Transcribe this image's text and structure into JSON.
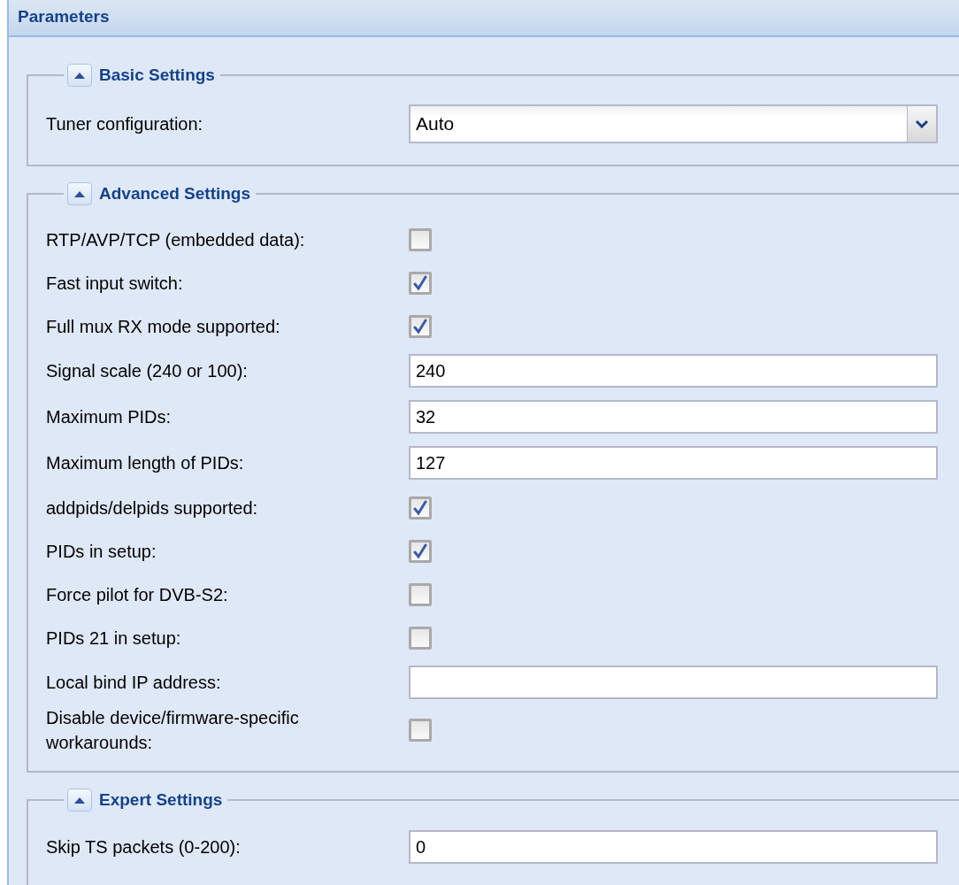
{
  "panel": {
    "title": "Parameters"
  },
  "sections": [
    {
      "title": "Basic Settings",
      "expanded": true,
      "rows": [
        {
          "kind": "select",
          "label": "Tuner configuration:",
          "value": "Auto"
        }
      ]
    },
    {
      "title": "Advanced Settings",
      "expanded": true,
      "rows": [
        {
          "kind": "checkbox",
          "label": "RTP/AVP/TCP (embedded data):",
          "checked": false
        },
        {
          "kind": "checkbox",
          "label": "Fast input switch:",
          "checked": true
        },
        {
          "kind": "checkbox",
          "label": "Full mux RX mode supported:",
          "checked": true
        },
        {
          "kind": "text",
          "label": "Signal scale (240 or 100):",
          "value": "240"
        },
        {
          "kind": "text",
          "label": "Maximum PIDs:",
          "value": "32"
        },
        {
          "kind": "text",
          "label": "Maximum length of PIDs:",
          "value": "127"
        },
        {
          "kind": "checkbox",
          "label": "addpids/delpids supported:",
          "checked": true
        },
        {
          "kind": "checkbox",
          "label": "PIDs in setup:",
          "checked": true
        },
        {
          "kind": "checkbox",
          "label": "Force pilot for DVB-S2:",
          "checked": false
        },
        {
          "kind": "checkbox",
          "label": "PIDs 21 in setup:",
          "checked": false
        },
        {
          "kind": "text",
          "label": "Local bind IP address:",
          "value": ""
        },
        {
          "kind": "checkbox",
          "label": "Disable device/firmware-specific workarounds:",
          "checked": false
        }
      ]
    },
    {
      "title": "Expert Settings",
      "expanded": true,
      "rows": [
        {
          "kind": "text",
          "label": "Skip TS packets (0-200):",
          "value": "0"
        }
      ]
    }
  ]
}
